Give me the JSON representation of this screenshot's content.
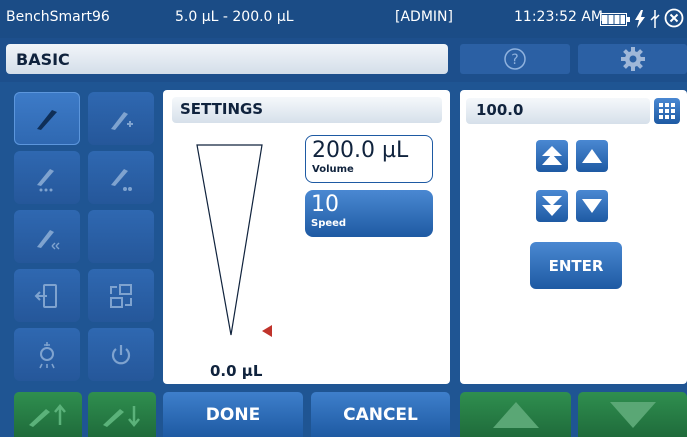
{
  "status_bar": {
    "device_name": "BenchSmart96",
    "volume_range": "5.0 µL - 200.0 µL",
    "user_role": "[ADMIN]",
    "time": "11:23:52 AM",
    "icons": [
      "battery-icon",
      "power-bolt-icon",
      "usb-icon",
      "close-icon"
    ]
  },
  "header": {
    "mode_label": "BASIC",
    "help_icon": "help-icon",
    "settings_icon": "gear-icon"
  },
  "sidebar": {
    "items": [
      {
        "icon": "pipette-icon",
        "active": true
      },
      {
        "icon": "pipette-add-icon",
        "active": false
      },
      {
        "icon": "pipette-dispense-icon",
        "active": false
      },
      {
        "icon": "pipette-dispense-multi-icon",
        "active": false
      },
      {
        "icon": "pipette-mix-icon",
        "active": false
      },
      {
        "icon": "empty",
        "active": false
      },
      {
        "icon": "exit-door-icon",
        "active": false
      },
      {
        "icon": "layout-icon",
        "active": false
      },
      {
        "icon": "light-bulb-icon",
        "active": false
      },
      {
        "icon": "power-icon",
        "active": false
      }
    ]
  },
  "settings": {
    "title": "SETTINGS",
    "volume_value": "200.0 µL",
    "volume_label": "Volume",
    "speed_value": "10",
    "speed_label": "Speed",
    "current_volume": "0.0 µL"
  },
  "keypad": {
    "value": "100.0",
    "enter_label": "ENTER",
    "keypad_icon": "keypad-icon"
  },
  "footer": {
    "done_label": "DONE",
    "cancel_label": "CANCEL"
  },
  "colors": {
    "background": "#1d4f8c",
    "accent_blue": "#1e5aa3",
    "accent_green": "#2f8f4f",
    "marker_red": "#c0332b"
  }
}
